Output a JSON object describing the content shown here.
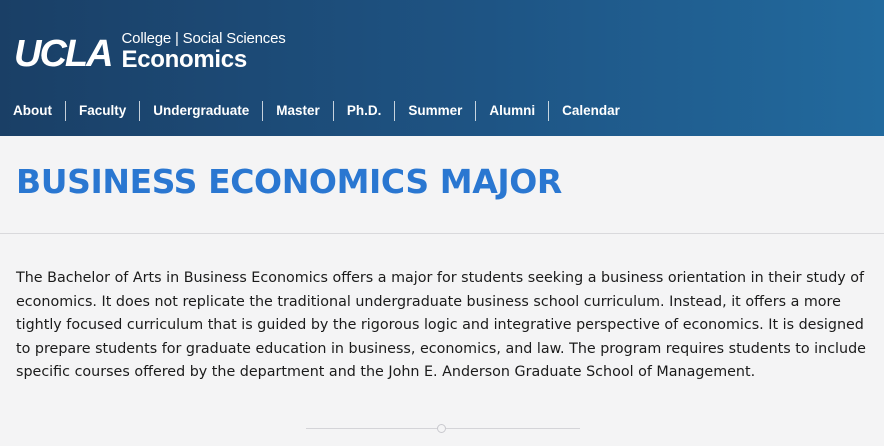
{
  "header": {
    "logo": {
      "ucla": "UCLA",
      "subtitle": "College | Social Sciences",
      "department": "Economics"
    },
    "nav": [
      {
        "label": "About"
      },
      {
        "label": "Faculty"
      },
      {
        "label": "Undergraduate"
      },
      {
        "label": "Master"
      },
      {
        "label": "Ph.D."
      },
      {
        "label": "Summer"
      },
      {
        "label": "Alumni"
      },
      {
        "label": "Calendar"
      }
    ]
  },
  "main": {
    "title": "BUSINESS ECONOMICS MAJOR",
    "intro": "The Bachelor of Arts in Business Economics offers a major for students seeking a business orientation in their study of economics. It does not replicate the traditional undergraduate business school curriculum. Instead, it offers a more tightly focused curriculum that is guided by the rigorous logic and integrative perspective of economics. It is designed to prepare students for graduate education in business, economics, and law. The program requires students to include specific courses offered by the department and the John E. Anderson Graduate School of Management."
  },
  "colors": {
    "header_dark": "#1a3f66",
    "header_light": "#226a9e",
    "title_blue": "#2a77d1",
    "page_background": "#f4f4f5"
  }
}
